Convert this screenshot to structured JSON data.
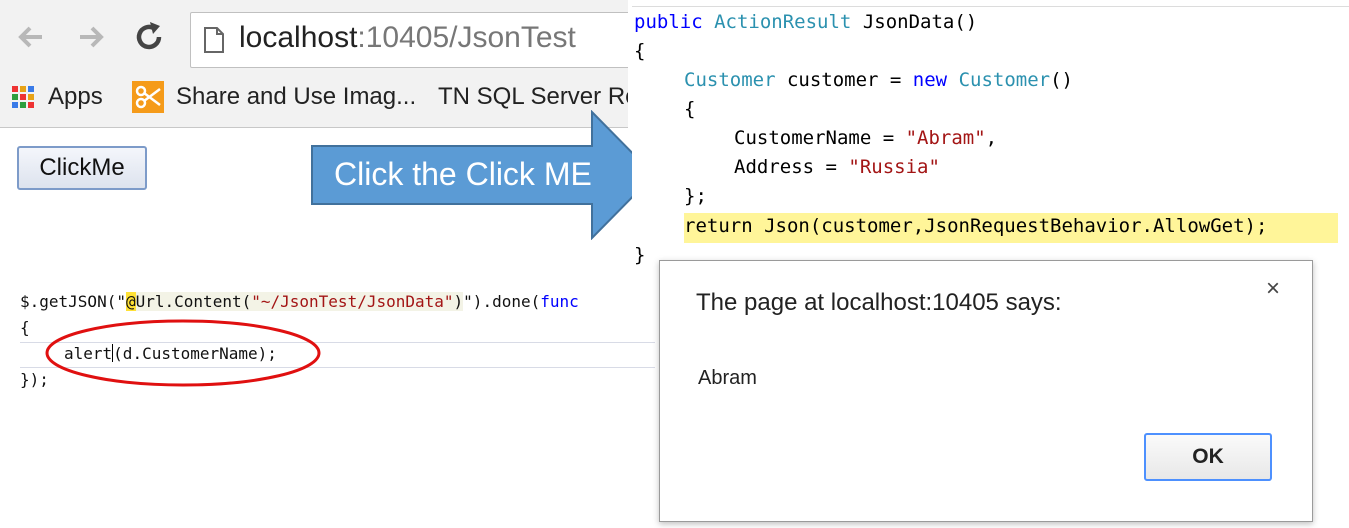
{
  "browser": {
    "url_host": "localhost",
    "url_rest": ":10405/JsonTest",
    "bookmarks": {
      "apps_label": "Apps",
      "share_label": "Share and Use Imag...",
      "tn_label": "TN SQL Server Re"
    }
  },
  "page": {
    "clickme_label": "ClickMe"
  },
  "annotation": {
    "arrow_label": "Click the Click ME",
    "arrow_color": "#5b9bd5",
    "ellipse_color": "#e01010"
  },
  "js_code": {
    "l1_a": "$.getJSON(\"",
    "l1_at": "@",
    "l1_url": "Url",
    "l1_b": ".",
    "l1_content": "Content",
    "l1_c": "(",
    "l1_str": "\"~/JsonTest/JsonData\"",
    "l1_d": ")",
    "l1_e": "\").done(",
    "l1_func": "func",
    "l2": "{",
    "l3_a": "alert",
    "l3_b": "(d.CustomerName);",
    "l4": "});"
  },
  "cs_code": {
    "l1_public": "public",
    "l1_type": "ActionResult",
    "l1_rest": " JsonData()",
    "l2": "{",
    "l3_type": "Customer",
    "l3_mid": " customer = ",
    "l3_new": "new",
    "l3_type2": "Customer",
    "l3_end": "()",
    "l4": "{",
    "l5_a": "CustomerName = ",
    "l5_str": "\"Abram\"",
    "l5_b": ",",
    "l6_a": "Address = ",
    "l6_str": "\"Russia\"",
    "l7": "};",
    "l8": "return Json(customer,JsonRequestBehavior.AllowGet);",
    "l9": "}"
  },
  "dialog": {
    "title": "The page at localhost:10405 says:",
    "close_symbol": "×",
    "message": "Abram",
    "ok_label": "OK"
  }
}
